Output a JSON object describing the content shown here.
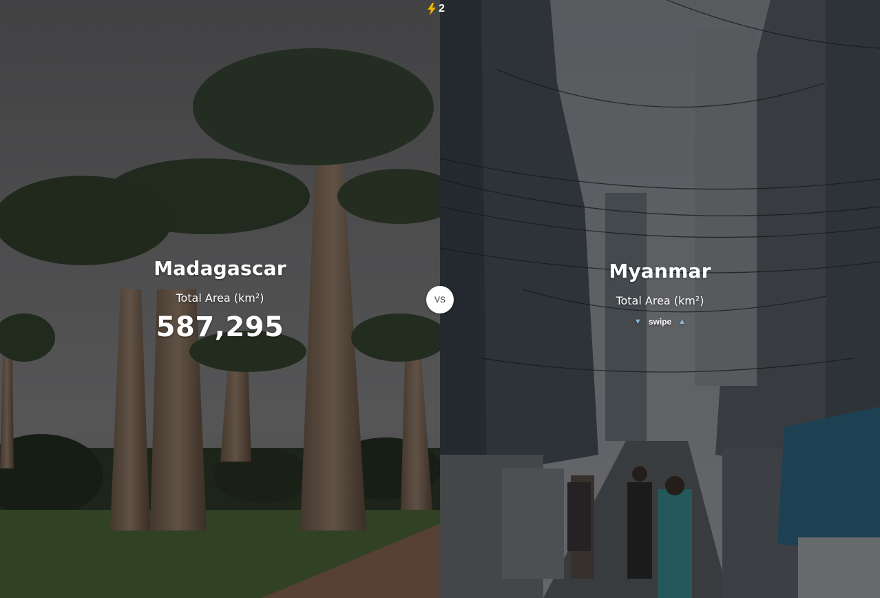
{
  "streak": {
    "icon": "lightning-icon",
    "count": "2"
  },
  "vs_label": "VS",
  "left": {
    "country": "Madagascar",
    "metric_label": "Total Area (km²)",
    "value": "587,295",
    "background": "baobab-trees-photo"
  },
  "right": {
    "country": "Myanmar",
    "metric_label": "Total Area (km²)",
    "hint_text": "swipe",
    "background": "city-street-photo"
  },
  "colors": {
    "accent_bolt": "#f5b400",
    "hint_arrow": "#9fd6ff"
  }
}
